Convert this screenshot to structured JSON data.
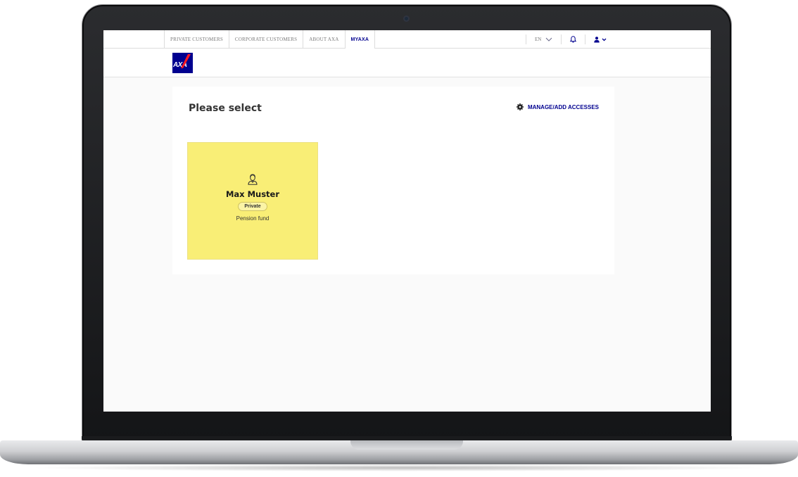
{
  "nav": {
    "tabs": [
      {
        "label": "PRIVATE CUSTOMERS"
      },
      {
        "label": "CORPORATE CUSTOMERS"
      },
      {
        "label": "ABOUT AXA"
      },
      {
        "label": "MYAXA"
      }
    ],
    "active_tab": "MYAXA",
    "language": "EN"
  },
  "logo": {
    "text": "AXA"
  },
  "main": {
    "title": "Please select",
    "manage_link": "MANAGE/ADD ACCESSES"
  },
  "access_tiles": [
    {
      "name": "Max Muster",
      "badge": "Private",
      "description": "Pension fund",
      "icon": "person-icon"
    }
  ],
  "colors": {
    "brand_blue": "#00008f",
    "tile_yellow": "#f9ee76",
    "logo_red": "#ff1721"
  }
}
